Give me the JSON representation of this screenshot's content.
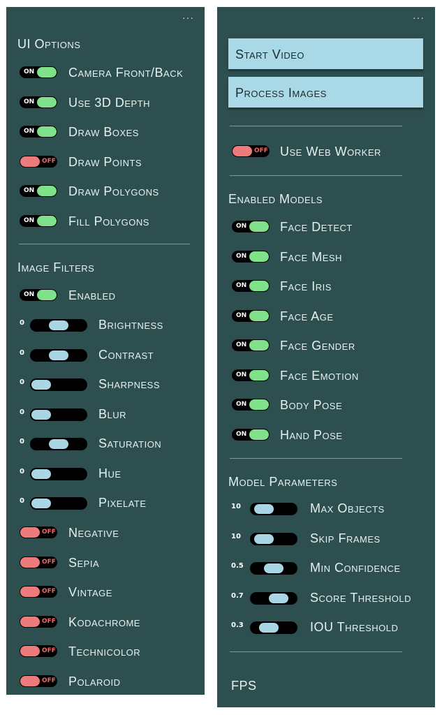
{
  "left": {
    "menu_icon": "ellipsis-icon",
    "ui_options": {
      "heading": "UI Options",
      "items": [
        {
          "label": "Camera Front/Back",
          "state": "ON"
        },
        {
          "label": "Use 3D Depth",
          "state": "ON"
        },
        {
          "label": "Draw Boxes",
          "state": "ON"
        },
        {
          "label": "Draw Points",
          "state": "OFF"
        },
        {
          "label": "Draw Polygons",
          "state": "ON"
        },
        {
          "label": "Fill Polygons",
          "state": "ON"
        }
      ]
    },
    "image_filters": {
      "heading": "Image Filters",
      "enabled": {
        "label": "Enabled",
        "state": "ON"
      },
      "sliders": [
        {
          "label": "Brightness",
          "value": "0",
          "position": 0.5
        },
        {
          "label": "Contrast",
          "value": "0",
          "position": 0.5
        },
        {
          "label": "Sharpness",
          "value": "0",
          "position": 0.0
        },
        {
          "label": "Blur",
          "value": "0",
          "position": 0.0
        },
        {
          "label": "Saturation",
          "value": "0",
          "position": 0.5
        },
        {
          "label": "Hue",
          "value": "0",
          "position": 0.0
        },
        {
          "label": "Pixelate",
          "value": "0",
          "position": 0.0
        }
      ],
      "toggles": [
        {
          "label": "Negative",
          "state": "OFF"
        },
        {
          "label": "Sepia",
          "state": "OFF"
        },
        {
          "label": "Vintage",
          "state": "OFF"
        },
        {
          "label": "Kodachrome",
          "state": "OFF"
        },
        {
          "label": "Technicolor",
          "state": "OFF"
        },
        {
          "label": "Polaroid",
          "state": "OFF"
        }
      ]
    }
  },
  "right": {
    "menu_icon": "ellipsis-icon",
    "buttons": {
      "start_video": "Start Video",
      "process_images": "Process Images"
    },
    "web_worker": {
      "label": "Use Web Worker",
      "state": "OFF"
    },
    "enabled_models": {
      "heading": "Enabled Models",
      "items": [
        {
          "label": "Face Detect",
          "state": "ON"
        },
        {
          "label": "Face Mesh",
          "state": "ON"
        },
        {
          "label": "Face Iris",
          "state": "ON"
        },
        {
          "label": "Face Age",
          "state": "ON"
        },
        {
          "label": "Face Gender",
          "state": "ON"
        },
        {
          "label": "Face Emotion",
          "state": "ON"
        },
        {
          "label": "Body Pose",
          "state": "ON"
        },
        {
          "label": "Hand Pose",
          "state": "ON"
        }
      ]
    },
    "model_parameters": {
      "heading": "Model Parameters",
      "sliders": [
        {
          "label": "Max Objects",
          "value": "10",
          "position": 0.1
        },
        {
          "label": "Skip Frames",
          "value": "10",
          "position": 0.1
        },
        {
          "label": "Min Confidence",
          "value": "0.5",
          "position": 0.5
        },
        {
          "label": "Score Threshold",
          "value": "0.7",
          "position": 0.7
        },
        {
          "label": "IOU Threshold",
          "value": "0.3",
          "position": 0.3
        }
      ]
    },
    "fps_label": "FPS"
  },
  "colors": {
    "panel_bg": "#2e4f4f",
    "toggle_on": "#7fe18a",
    "toggle_off": "#ee7b7b",
    "slider_thumb": "#a9d5e4",
    "button_bg": "#a9d8e6"
  }
}
